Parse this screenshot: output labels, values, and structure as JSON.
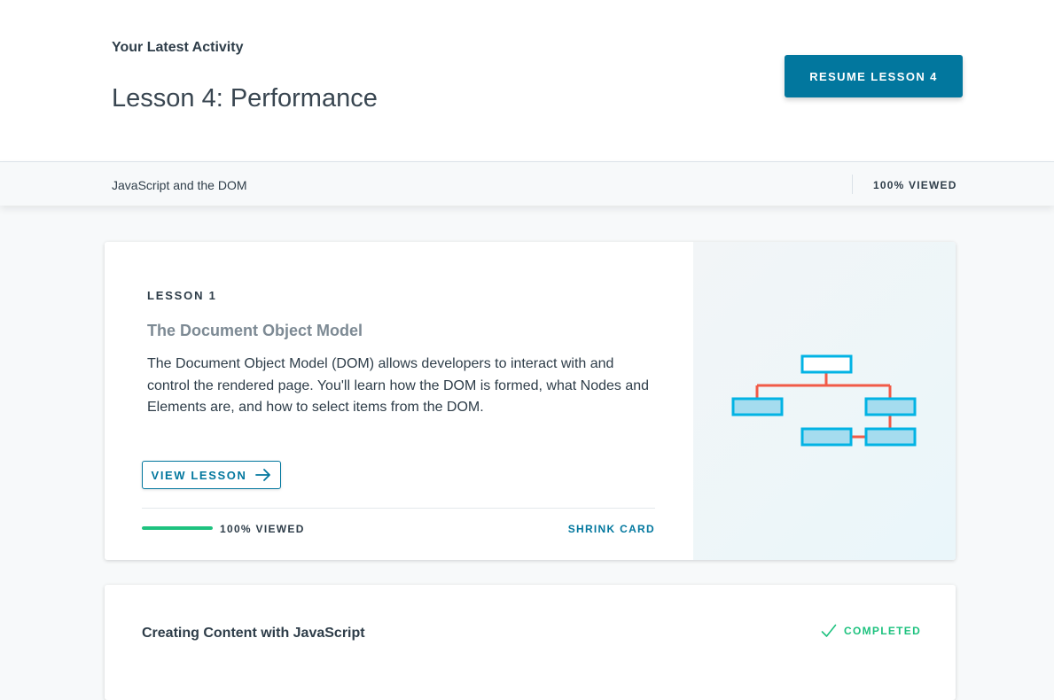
{
  "activity": {
    "eyebrow": "Your Latest Activity",
    "title": "Lesson 4: Performance",
    "resume_label": "Resume Lesson 4"
  },
  "course": {
    "name": "JavaScript and the DOM",
    "viewed": "100% Viewed"
  },
  "lesson_card": {
    "eyebrow": "Lesson 1",
    "title": "The Document Object Model",
    "description": "The Document Object Model (DOM) allows developers to interact with and control the rendered page. You'll learn how the DOM is formed, what Nodes and Elements are, and how to select items from the DOM.",
    "view_label": "View Lesson",
    "progress_fraction": 1.0,
    "progress_label": "100% Viewed",
    "shrink_label": "Shrink Card",
    "arrow_icon": "arrow-right-icon",
    "art_icon": "dom-tree-illustration"
  },
  "next_lesson": {
    "title": "Creating Content with JavaScript",
    "status": "Completed",
    "status_icon": "check-icon"
  },
  "colors": {
    "accent": "#02779e",
    "success": "#1ec27f",
    "tree_box": "#02b3e4",
    "tree_box_fill": "#a5dcef",
    "tree_line": "#f15a47"
  }
}
